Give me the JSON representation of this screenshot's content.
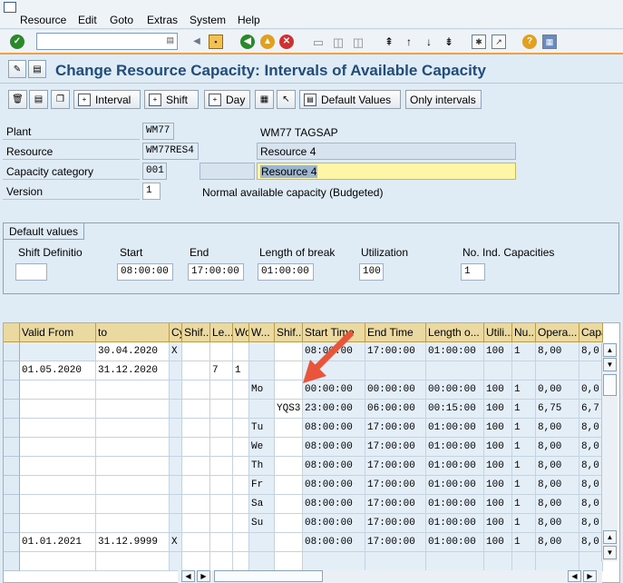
{
  "menu": [
    "Resource",
    "Edit",
    "Goto",
    "Extras",
    "System",
    "Help"
  ],
  "command_field": {
    "value": ""
  },
  "title": "Change Resource Capacity: Intervals of Available Capacity",
  "app_toolbar": {
    "interval": "Interval",
    "shift": "Shift",
    "day": "Day",
    "default_values": "Default Values",
    "only_intervals": "Only intervals"
  },
  "header": {
    "plant_label": "Plant",
    "plant_value": "WM77",
    "plant_name": "WM77 TAGSAP",
    "resource_label": "Resource",
    "resource_value": "WM77RES4",
    "resource_desc": "Resource 4",
    "capcat_label": "Capacity category",
    "capcat_value": "001",
    "capcat_extra": "",
    "capcat_desc": "Resource 4",
    "version_label": "Version",
    "version_value": "1",
    "version_desc": "Normal available capacity (Budgeted)"
  },
  "defaults": {
    "title": "Default values",
    "labels": {
      "shift_def": "Shift Definitio",
      "start": "Start",
      "end": "End",
      "break": "Length of break",
      "util": "Utilization",
      "num_caps": "No. Ind. Capacities"
    },
    "values": {
      "shift_def": "",
      "start": "08:00:00",
      "end": "17:00:00",
      "break": "01:00:00",
      "util": "100",
      "num_caps": "1"
    }
  },
  "grid": {
    "headers": [
      "Valid From",
      "to",
      "Cy",
      "Shif...",
      "Le...",
      "Wo",
      "W...",
      "Shif...",
      "Start Time",
      "End Time",
      "Length o...",
      "Utili...",
      "Nu...",
      "Opera...",
      "Capa"
    ],
    "rows": [
      [
        "",
        "30.04.2020",
        "X",
        "",
        "",
        "",
        "",
        "",
        "08:00:00",
        "17:00:00",
        "01:00:00",
        "100",
        "1",
        "8,00",
        "8,0"
      ],
      [
        "01.05.2020",
        "31.12.2020",
        "",
        "",
        "7",
        "1",
        "",
        "",
        "",
        "",
        "",
        "",
        "",
        "",
        ""
      ],
      [
        "",
        "",
        "",
        "",
        "",
        "",
        "Mo",
        "",
        "00:00:00",
        "00:00:00",
        "00:00:00",
        "100",
        "1",
        "0,00",
        "0,0"
      ],
      [
        "",
        "",
        "",
        "",
        "",
        "",
        "",
        "YQS3",
        "23:00:00",
        "06:00:00",
        "00:15:00",
        "100",
        "1",
        "6,75",
        "6,7"
      ],
      [
        "",
        "",
        "",
        "",
        "",
        "",
        "Tu",
        "",
        "08:00:00",
        "17:00:00",
        "01:00:00",
        "100",
        "1",
        "8,00",
        "8,0"
      ],
      [
        "",
        "",
        "",
        "",
        "",
        "",
        "We",
        "",
        "08:00:00",
        "17:00:00",
        "01:00:00",
        "100",
        "1",
        "8,00",
        "8,0"
      ],
      [
        "",
        "",
        "",
        "",
        "",
        "",
        "Th",
        "",
        "08:00:00",
        "17:00:00",
        "01:00:00",
        "100",
        "1",
        "8,00",
        "8,0"
      ],
      [
        "",
        "",
        "",
        "",
        "",
        "",
        "Fr",
        "",
        "08:00:00",
        "17:00:00",
        "01:00:00",
        "100",
        "1",
        "8,00",
        "8,0"
      ],
      [
        "",
        "",
        "",
        "",
        "",
        "",
        "Sa",
        "",
        "08:00:00",
        "17:00:00",
        "01:00:00",
        "100",
        "1",
        "8,00",
        "8,0"
      ],
      [
        "",
        "",
        "",
        "",
        "",
        "",
        "Su",
        "",
        "08:00:00",
        "17:00:00",
        "01:00:00",
        "100",
        "1",
        "8,00",
        "8,0"
      ],
      [
        "01.01.2021",
        "31.12.9999",
        "X",
        "",
        "",
        "",
        "",
        "",
        "08:00:00",
        "17:00:00",
        "01:00:00",
        "100",
        "1",
        "8,00",
        "8,0"
      ],
      [
        "",
        "",
        "",
        "",
        "",
        "",
        "",
        "",
        "",
        "",
        "",
        "",
        "",
        "",
        ""
      ]
    ]
  },
  "colors": {
    "background": "#dfebf5",
    "title": "#224c7a",
    "grid_header": "#ebd9a2",
    "highlight_field": "#fef6a6",
    "arrow": "#e8553b",
    "toolbar_accent": "#f0a040"
  }
}
